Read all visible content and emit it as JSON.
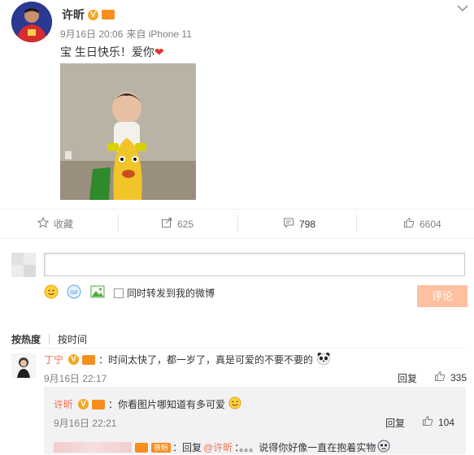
{
  "post": {
    "author": "许昕",
    "time": "9月16日 20:06",
    "source": "来自 iPhone 11",
    "text": "宝 生日快乐！爱你",
    "heart": "❤"
  },
  "actions": {
    "favorite": "收藏",
    "repost": "625",
    "comment": "798",
    "like": "6604"
  },
  "composer": {
    "checkbox_label": "同时转发到我的微博",
    "submit": "评论"
  },
  "sort": {
    "hot": "按热度",
    "time": "按时间"
  },
  "comments": [
    {
      "author": "丁宁",
      "text": "：时间太快了，都一岁了，真是可爱的不要不要的",
      "time": "9月16日 22:17",
      "reply": "回复",
      "likes": "335"
    }
  ],
  "sub_comments": [
    {
      "author": "许昕",
      "text": "：你看图片哪知道有多可爱",
      "time": "9月16日 22:21",
      "reply": "回复",
      "likes": "104"
    },
    {
      "badge": "铁粉",
      "prefix": "：回复",
      "mention": "@许昕",
      "text": "：。。。说得你好像一直在抱着实物"
    }
  ],
  "colors": {
    "accent": "#eb7350",
    "button_disabled": "#ffc09f",
    "vip_badge": "#f5a623",
    "heart": "#e5312b"
  }
}
